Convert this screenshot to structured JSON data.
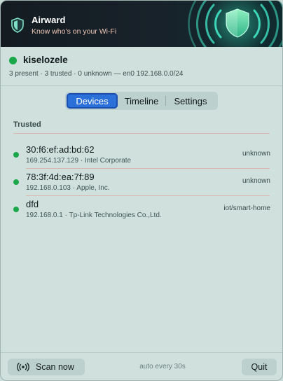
{
  "banner": {
    "title": "Airward",
    "subtitle": "Know who’s on your Wi‑Fi"
  },
  "network": {
    "name": "kiselozele",
    "status_color": "#1aa84a",
    "stats": "3 present · 3 trusted · 0 unknown  —  en0 192.168.0.0/24"
  },
  "tabs": [
    {
      "label": "Devices",
      "active": true
    },
    {
      "label": "Timeline",
      "active": false
    },
    {
      "label": "Settings",
      "active": false
    }
  ],
  "section": {
    "title": "Trusted"
  },
  "devices": [
    {
      "name": "30:f6:ef:ad:bd:62",
      "ip": "169.254.137.129",
      "vendor": "Intel Corporate",
      "tag": "unknown"
    },
    {
      "name": "78:3f:4d:ea:7f:89",
      "ip": "192.168.0.103",
      "vendor": "Apple, Inc.",
      "tag": "unknown"
    },
    {
      "name": "dfd",
      "ip": "192.168.0.1",
      "vendor": "Tp-Link Technologies Co.,Ltd.",
      "tag": "iot/smart-home"
    }
  ],
  "footer": {
    "scan_label": "Scan now",
    "auto_label": "auto every 30s",
    "quit_label": "Quit"
  },
  "colors": {
    "accent": "#2b6fd8",
    "online": "#1aa84a",
    "banner_bg": "#141c22"
  }
}
